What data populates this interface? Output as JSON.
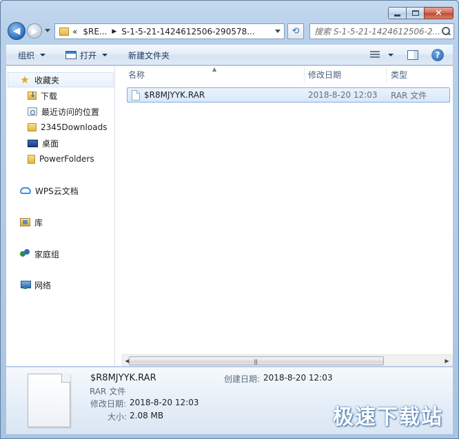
{
  "window": {
    "caption_min": "─",
    "caption_close": "✕"
  },
  "navbar": {
    "address": {
      "overflow": "«",
      "segment1": "$RE...",
      "segment2": "S-1-5-21-1424612506-290578..."
    },
    "search_placeholder": "搜索 S-1-5-21-1424612506-2..."
  },
  "toolbar": {
    "organize": "组织",
    "open": "打开",
    "new_folder": "新建文件夹"
  },
  "nav_pane": {
    "favorites": "收藏夹",
    "downloads": "下载",
    "recent": "最近访问的位置",
    "downloads_2345": "2345Downloads",
    "desktop": "桌面",
    "powerfolders": "PowerFolders",
    "wps_cloud": "WPS云文档",
    "libraries": "库",
    "homegroup": "家庭组",
    "network": "网络"
  },
  "columns": {
    "name": "名称",
    "modified": "修改日期",
    "type": "类型"
  },
  "files": [
    {
      "name": "$R8MJYYK.RAR",
      "modified": "2018-8-20 12:03",
      "type": "RAR 文件"
    }
  ],
  "details": {
    "file_name": "$R8MJYYK.RAR",
    "file_type": "RAR 文件",
    "created_label": "创建日期:",
    "created_value": "2018-8-20 12:03",
    "modified_label": "修改日期:",
    "modified_value": "2018-8-20 12:03",
    "size_label": "大小:",
    "size_value": "2.08 MB"
  },
  "watermark": "极速下载站"
}
